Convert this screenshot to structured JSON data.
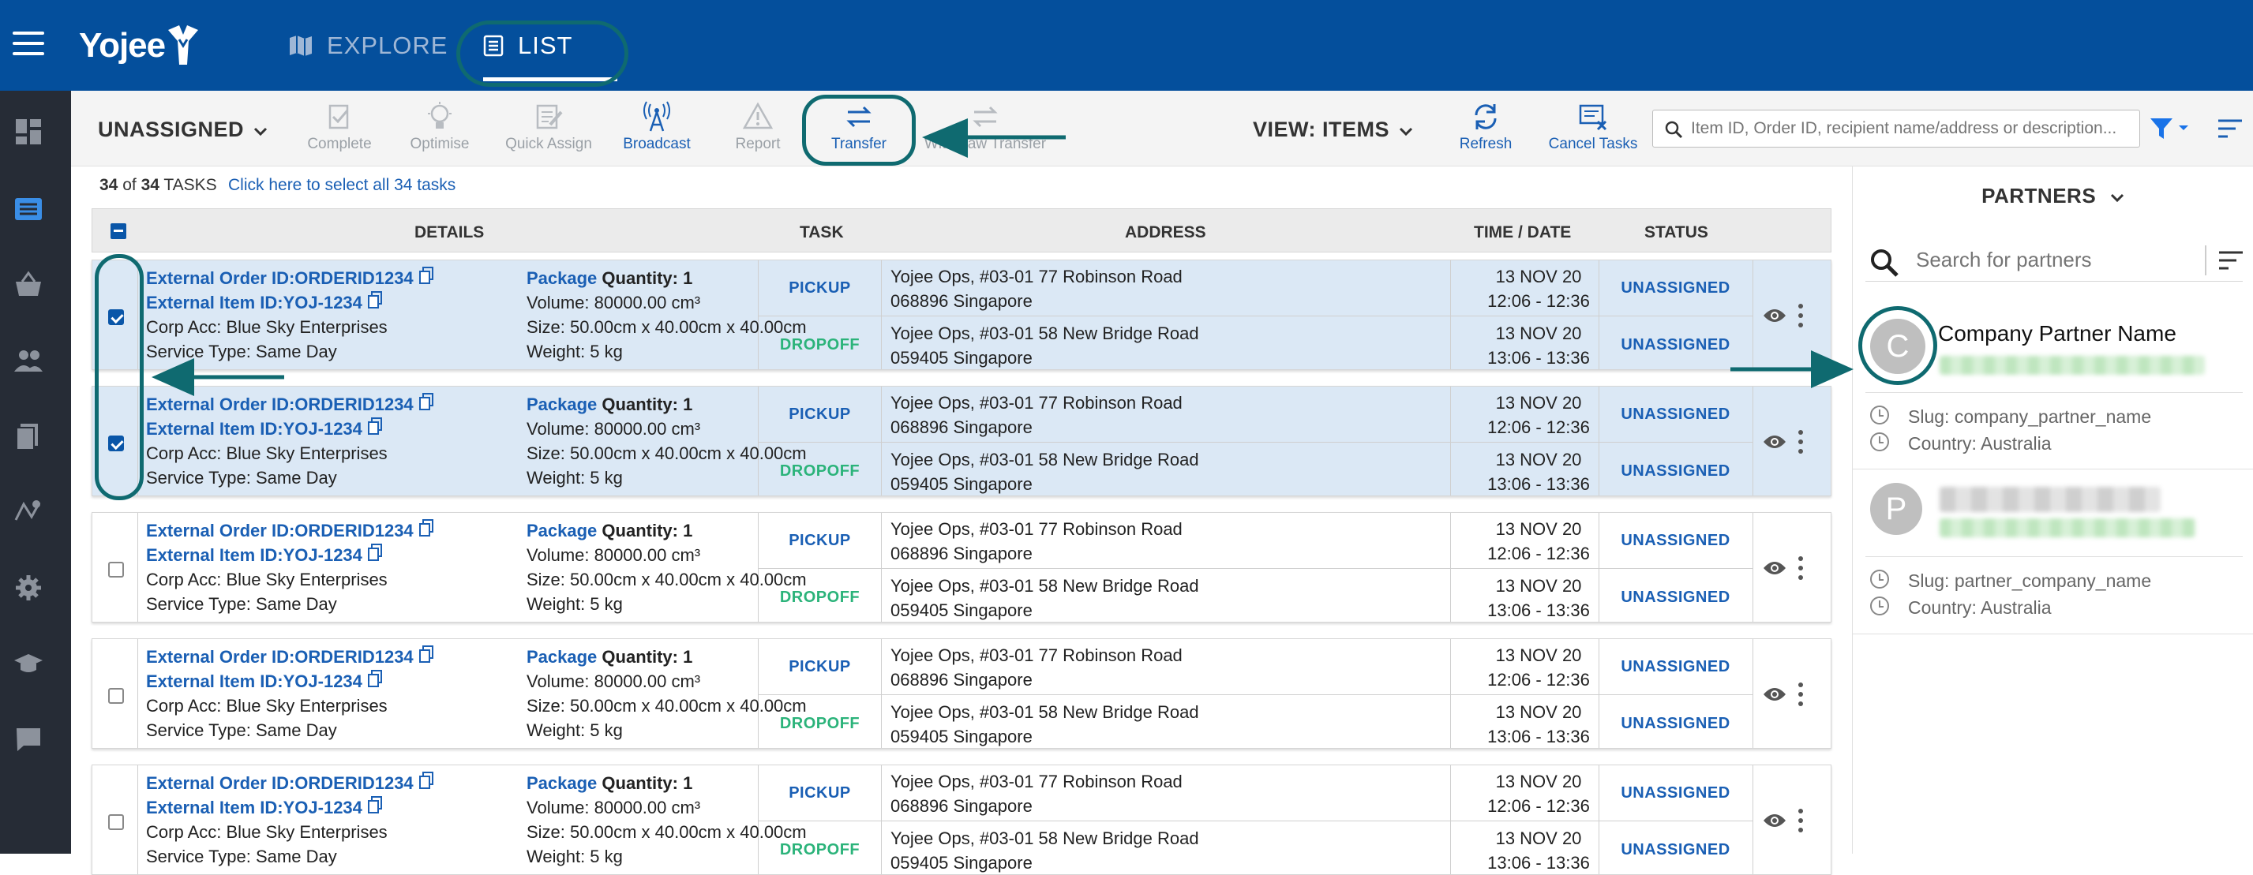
{
  "brand": {
    "name": "Yojee",
    "top_color": "#044f9c",
    "accent": "#1a5fb4",
    "dropoff_color": "#2bb37a",
    "highlight_ring": "#0f6a70"
  },
  "nav": {
    "explore": "EXPLORE",
    "list": "LIST"
  },
  "sidebar": {
    "icons": [
      "dashboard-icon",
      "list-icon",
      "basket-icon",
      "people-icon",
      "documents-icon",
      "map-pin-icon",
      "settings-icon",
      "school-icon",
      "chat-icon"
    ]
  },
  "toolbar": {
    "unassigned": "UNASSIGNED",
    "complete": "Complete",
    "optimise": "Optimise",
    "quick_assign": "Quick Assign",
    "broadcast": "Broadcast",
    "report": "Report",
    "transfer": "Transfer",
    "withdraw": "Withdraw Transfer",
    "view_items": "VIEW: ITEMS",
    "refresh": "Refresh",
    "cancel_tasks": "Cancel Tasks",
    "search_placeholder": "Item ID, Order ID, recipient name/address or description..."
  },
  "summary": {
    "shown": "34",
    "of": "of",
    "total": "34",
    "label": "TASKS",
    "select_all": "Click here to select all 34 tasks"
  },
  "table": {
    "headers": [
      "DETAILS",
      "TASK",
      "ADDRESS",
      "TIME / DATE",
      "STATUS"
    ]
  },
  "rows": [
    {
      "selected": true,
      "order": "External Order ID:ORDERID1234",
      "item": "External Item ID:YOJ-1234",
      "corp": "Corp Acc: Blue Sky Enterprises",
      "service": "Service Type: Same Day",
      "pkg": "Package",
      "qty": "Quantity: 1",
      "volume": "Volume: 80000.00 cm³",
      "size": "Size: 50.00cm x 40.00cm x 40.00cm",
      "weight": "Weight: 5 kg",
      "task1": "PICKUP",
      "task2": "DROPOFF",
      "addr1a": "Yojee Ops, #03-01 77 Robinson Road",
      "addr1b": "068896 Singapore",
      "addr2a": "Yojee Ops, #03-01 58 New Bridge Road",
      "addr2b": "059405 Singapore",
      "date1": "13 NOV 20",
      "time1": "12:06 - 12:36",
      "date2": "13 NOV 20",
      "time2": "13:06 - 13:36",
      "status1": "UNASSIGNED",
      "status2": "UNASSIGNED"
    },
    {
      "selected": true,
      "order": "External Order ID:ORDERID1234",
      "item": "External Item ID:YOJ-1234",
      "corp": "Corp Acc: Blue Sky Enterprises",
      "service": "Service Type: Same Day",
      "pkg": "Package",
      "qty": "Quantity: 1",
      "volume": "Volume: 80000.00 cm³",
      "size": "Size: 50.00cm x 40.00cm x 40.00cm",
      "weight": "Weight: 5 kg",
      "task1": "PICKUP",
      "task2": "DROPOFF",
      "addr1a": "Yojee Ops, #03-01 77 Robinson Road",
      "addr1b": "068896 Singapore",
      "addr2a": "Yojee Ops, #03-01 58 New Bridge Road",
      "addr2b": "059405 Singapore",
      "date1": "13 NOV 20",
      "time1": "12:06 - 12:36",
      "date2": "13 NOV 20",
      "time2": "13:06 - 13:36",
      "status1": "UNASSIGNED",
      "status2": "UNASSIGNED"
    },
    {
      "selected": false,
      "order": "External Order ID:ORDERID1234",
      "item": "External Item ID:YOJ-1234",
      "corp": "Corp Acc: Blue Sky Enterprises",
      "service": "Service Type: Same Day",
      "pkg": "Package",
      "qty": "Quantity: 1",
      "volume": "Volume: 80000.00 cm³",
      "size": "Size: 50.00cm x 40.00cm x 40.00cm",
      "weight": "Weight: 5 kg",
      "task1": "PICKUP",
      "task2": "DROPOFF",
      "addr1a": "Yojee Ops, #03-01 77 Robinson Road",
      "addr1b": "068896 Singapore",
      "addr2a": "Yojee Ops, #03-01 58 New Bridge Road",
      "addr2b": "059405 Singapore",
      "date1": "13 NOV 20",
      "time1": "12:06 - 12:36",
      "date2": "13 NOV 20",
      "time2": "13:06 - 13:36",
      "status1": "UNASSIGNED",
      "status2": "UNASSIGNED"
    },
    {
      "selected": false,
      "order": "External Order ID:ORDERID1234",
      "item": "External Item ID:YOJ-1234",
      "corp": "Corp Acc: Blue Sky Enterprises",
      "service": "Service Type: Same Day",
      "pkg": "Package",
      "qty": "Quantity: 1",
      "volume": "Volume: 80000.00 cm³",
      "size": "Size: 50.00cm x 40.00cm x 40.00cm",
      "weight": "Weight: 5 kg",
      "task1": "PICKUP",
      "task2": "DROPOFF",
      "addr1a": "Yojee Ops, #03-01 77 Robinson Road",
      "addr1b": "068896 Singapore",
      "addr2a": "Yojee Ops, #03-01 58 New Bridge Road",
      "addr2b": "059405 Singapore",
      "date1": "13 NOV 20",
      "time1": "12:06 - 12:36",
      "date2": "13 NOV 20",
      "time2": "13:06 - 13:36",
      "status1": "UNASSIGNED",
      "status2": "UNASSIGNED"
    },
    {
      "selected": false,
      "order": "External Order ID:ORDERID1234",
      "item": "External Item ID:YOJ-1234",
      "corp": "Corp Acc: Blue Sky Enterprises",
      "service": "Service Type: Same Day",
      "pkg": "Package",
      "qty": "Quantity: 1",
      "volume": "Volume: 80000.00 cm³",
      "size": "Size: 50.00cm x 40.00cm x 40.00cm",
      "weight": "Weight: 5 kg",
      "task1": "PICKUP",
      "task2": "DROPOFF",
      "addr1a": "Yojee Ops, #03-01 77 Robinson Road",
      "addr1b": "068896 Singapore",
      "addr2a": "Yojee Ops, #03-01 58 New Bridge Road",
      "addr2b": "059405 Singapore",
      "date1": "13 NOV 20",
      "time1": "12:06 - 12:36",
      "date2": "13 NOV 20",
      "time2": "13:06 - 13:36",
      "status1": "UNASSIGNED",
      "status2": "UNASSIGNED"
    }
  ],
  "partners": {
    "title": "PARTNERS",
    "search_placeholder": "Search for partners",
    "list": [
      {
        "initial": "C",
        "name": "Company Partner Name",
        "slug": "Slug: company_partner_name",
        "country": "Country: Australia"
      },
      {
        "initial": "P",
        "name": "",
        "slug": "Slug: partner_company_name",
        "country": "Country: Australia"
      }
    ]
  }
}
